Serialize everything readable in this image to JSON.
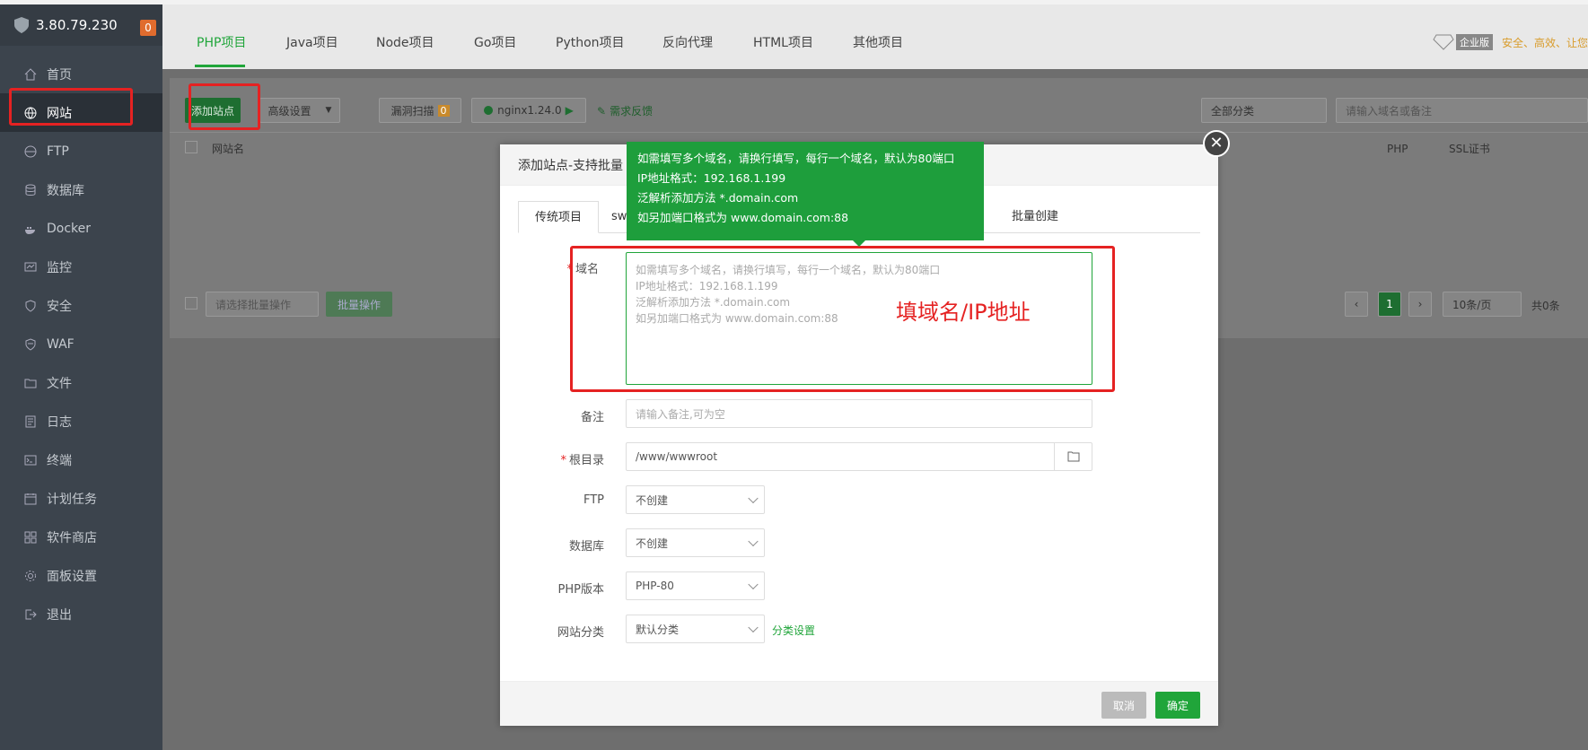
{
  "host": {
    "ip": "3.80.79.230",
    "badge": "0"
  },
  "sidebar": {
    "items": [
      {
        "label": "首页",
        "icon": "home-icon"
      },
      {
        "label": "网站",
        "icon": "globe-icon"
      },
      {
        "label": "FTP",
        "icon": "ftp-icon"
      },
      {
        "label": "数据库",
        "icon": "database-icon"
      },
      {
        "label": "Docker",
        "icon": "docker-icon"
      },
      {
        "label": "监控",
        "icon": "monitor-icon"
      },
      {
        "label": "安全",
        "icon": "shield-icon"
      },
      {
        "label": "WAF",
        "icon": "waf-icon"
      },
      {
        "label": "文件",
        "icon": "folder-icon"
      },
      {
        "label": "日志",
        "icon": "log-icon"
      },
      {
        "label": "终端",
        "icon": "terminal-icon"
      },
      {
        "label": "计划任务",
        "icon": "calendar-icon"
      },
      {
        "label": "软件商店",
        "icon": "store-icon"
      },
      {
        "label": "面板设置",
        "icon": "gear-icon"
      },
      {
        "label": "退出",
        "icon": "logout-icon"
      }
    ]
  },
  "tabs": {
    "items": [
      "PHP项目",
      "Java项目",
      "Node项目",
      "Go项目",
      "Python项目",
      "反向代理",
      "HTML项目",
      "其他项目"
    ],
    "enterprise_badge": "企业版",
    "enterprise_text": "安全、高效、让您"
  },
  "toolbar": {
    "add_site": "添加站点",
    "advanced": "高级设置",
    "vuln_scan": "漏洞扫描",
    "vuln_count": "0",
    "nginx": "nginx1.24.0",
    "feedback": "需求反馈",
    "category": "全部分类",
    "search_placeholder": "请输入域名或备注"
  },
  "table": {
    "col_site": "网站名",
    "col_php": "PHP",
    "col_ssl": "SSL证书",
    "batch_placeholder": "请选择批量操作",
    "batch_btn": "批量操作",
    "page": "1",
    "per_page": "10条/页",
    "total": "共0条"
  },
  "modal": {
    "title": "添加站点-支持批量",
    "tabs": [
      "传统项目",
      "sw",
      "批量创建"
    ],
    "domain_label": "域名",
    "domain_lines": [
      "如需填写多个域名，请换行填写，每行一个域名，默认为80端口",
      "IP地址格式：192.168.1.199",
      "泛解析添加方法 *.domain.com",
      "如另加端口格式为 www.domain.com:88"
    ],
    "remark_label": "备注",
    "remark_placeholder": "请输入备注,可为空",
    "root_label": "根目录",
    "root_value": "/www/wwwroot",
    "ftp_label": "FTP",
    "ftp_value": "不创建",
    "db_label": "数据库",
    "db_value": "不创建",
    "php_label": "PHP版本",
    "php_value": "PHP-80",
    "cat_label": "网站分类",
    "cat_value": "默认分类",
    "cat_link": "分类设置",
    "cancel": "取消",
    "confirm": "确定"
  },
  "tooltip": {
    "lines": [
      "如需填写多个域名，请换行填写，每行一个域名，默认为80端口",
      "IP地址格式：192.168.1.199",
      "泛解析添加方法 *.domain.com",
      "如另加端口格式为 www.domain.com:88"
    ]
  },
  "annotation": "填域名/IP地址",
  "colors": {
    "accent": "#20a53a",
    "annotation": "#e52222",
    "sidebar": "#3c444d"
  }
}
